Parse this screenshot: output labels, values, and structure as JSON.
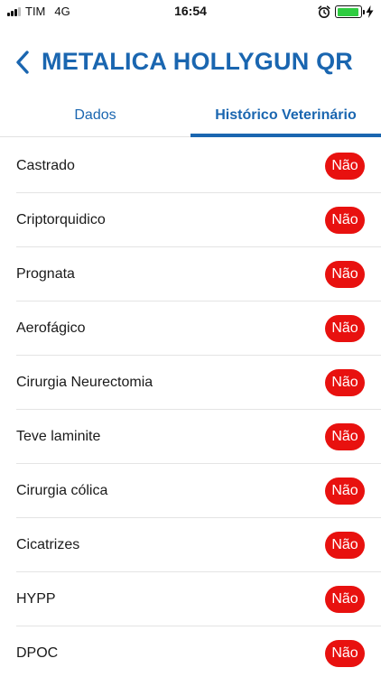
{
  "status_bar": {
    "carrier": "TIM",
    "network": "4G",
    "time": "16:54",
    "battery_level": 0.95,
    "battery_color": "#2ecc40"
  },
  "header": {
    "back_icon": "chevron-left-icon",
    "title": "METALICA HOLLYGUN QR"
  },
  "tabs": [
    {
      "label": "Dados",
      "active": false
    },
    {
      "label": "Histórico Veterinário",
      "active": true
    }
  ],
  "items": [
    {
      "label": "Castrado",
      "value": "Não"
    },
    {
      "label": "Criptorquidico",
      "value": "Não"
    },
    {
      "label": "Prognata",
      "value": "Não"
    },
    {
      "label": "Aerofágico",
      "value": "Não"
    },
    {
      "label": "Cirurgia Neurectomia",
      "value": "Não"
    },
    {
      "label": "Teve laminite",
      "value": "Não"
    },
    {
      "label": "Cirurgia cólica",
      "value": "Não"
    },
    {
      "label": "Cicatrizes",
      "value": "Não"
    },
    {
      "label": "HYPP",
      "value": "Não"
    },
    {
      "label": "DPOC",
      "value": "Não"
    }
  ],
  "colors": {
    "accent": "#1a66b0",
    "badge": "#e8110f"
  }
}
